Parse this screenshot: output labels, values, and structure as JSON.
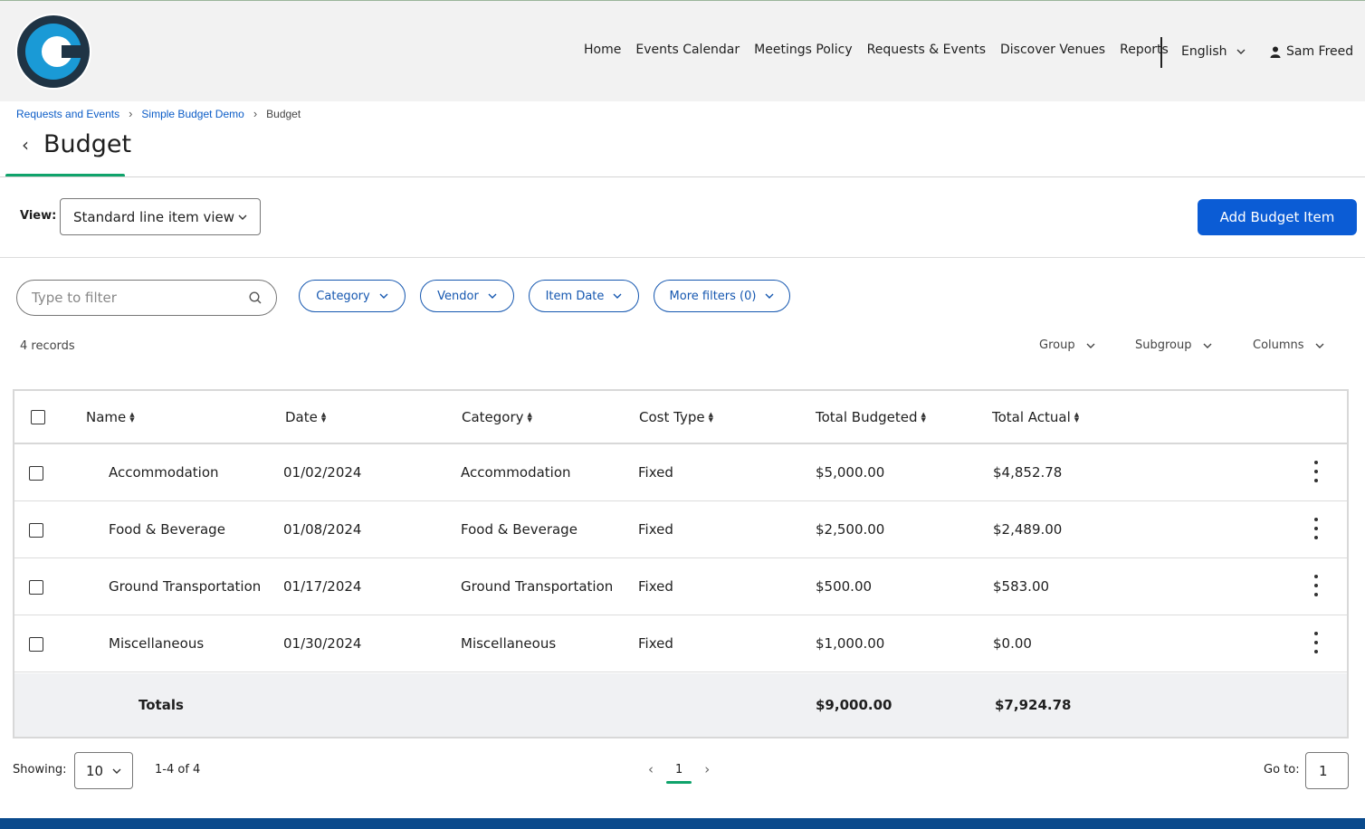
{
  "header": {
    "nav": [
      "Home",
      "Events Calendar",
      "Meetings Policy",
      "Requests & Events",
      "Discover Venues",
      "Reports"
    ],
    "language": "English",
    "user": "Sam Freed"
  },
  "breadcrumb": {
    "items": [
      "Requests and Events",
      "Simple Budget Demo"
    ],
    "current": "Budget"
  },
  "page_title": "Budget",
  "view": {
    "label": "View:",
    "selected": "Standard line item view"
  },
  "add_button": "Add Budget Item",
  "filter": {
    "placeholder": "Type to filter",
    "pills": [
      "Category",
      "Vendor",
      "Item Date",
      "More filters (0)"
    ]
  },
  "records_count": "4 records",
  "grouping": {
    "group": "Group",
    "subgroup": "Subgroup",
    "columns": "Columns"
  },
  "table": {
    "headers": [
      "Name",
      "Date",
      "Category",
      "Cost Type",
      "Total Budgeted",
      "Total Actual"
    ],
    "rows": [
      {
        "name": "Accommodation",
        "date": "01/02/2024",
        "category": "Accommodation",
        "cost_type": "Fixed",
        "budgeted": "$5,000.00",
        "actual": "$4,852.78"
      },
      {
        "name": "Food & Beverage",
        "date": "01/08/2024",
        "category": "Food & Beverage",
        "cost_type": "Fixed",
        "budgeted": "$2,500.00",
        "actual": "$2,489.00"
      },
      {
        "name": "Ground Transportation",
        "date": "01/17/2024",
        "category": "Ground Transportation",
        "cost_type": "Fixed",
        "budgeted": "$500.00",
        "actual": "$583.00"
      },
      {
        "name": "Miscellaneous",
        "date": "01/30/2024",
        "category": "Miscellaneous",
        "cost_type": "Fixed",
        "budgeted": "$1,000.00",
        "actual": "$0.00"
      }
    ],
    "totals": {
      "label": "Totals",
      "budgeted": "$9,000.00",
      "actual": "$7,924.78"
    }
  },
  "pagination": {
    "showing_label": "Showing:",
    "page_size": "10",
    "range": "1-4 of 4",
    "current_page": "1",
    "goto_label": "Go to:",
    "goto_value": "1"
  },
  "colors": {
    "primary": "#0b5cd5",
    "link": "#1557b0",
    "accent_green": "#0fa36b",
    "footer": "#0a4a8c"
  }
}
